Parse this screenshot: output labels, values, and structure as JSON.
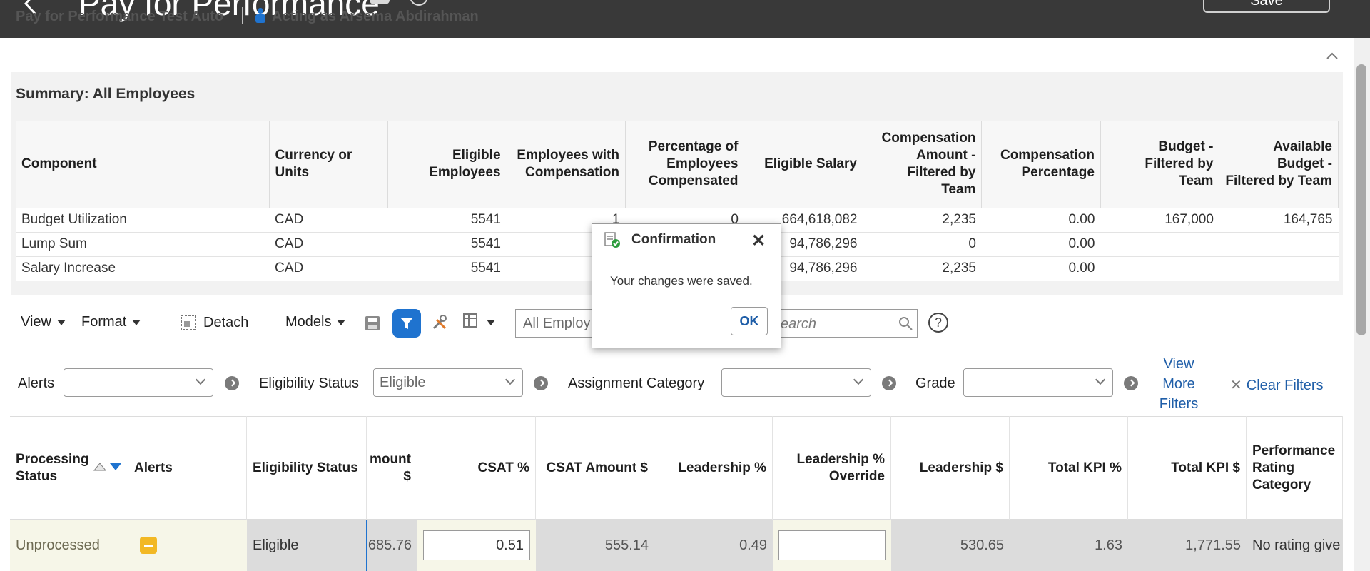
{
  "header": {
    "title": "Pay for Performance",
    "save_label": "Save"
  },
  "context": {
    "plan_name": "Pay for Performance Test Auto",
    "acting_as": "Acting as Arsema Abdirahman"
  },
  "summary": {
    "title": "Summary: All Employees",
    "columns": [
      "Component",
      "Currency or Units",
      "Eligible Employees",
      "Employees with Compensation",
      "Percentage of Employees Compensated",
      "Eligible Salary",
      "Compensation Amount - Filtered by Team",
      "Compensation Percentage",
      "Budget - Filtered by Team",
      "Available Budget - Filtered by Team"
    ],
    "rows": [
      {
        "component": "Budget Utilization",
        "currency": "CAD",
        "eligible": "5541",
        "with_comp": "1",
        "pct_comp": "0",
        "salary": "664,618,082",
        "comp_amount": "2,235",
        "comp_pct": "0.00",
        "budget": "167,000",
        "available": "164,765"
      },
      {
        "component": "Lump Sum",
        "currency": "CAD",
        "eligible": "5541",
        "with_comp": "",
        "pct_comp": "",
        "salary": "94,786,296",
        "comp_amount": "0",
        "comp_pct": "0.00",
        "budget": "",
        "available": ""
      },
      {
        "component": "Salary Increase",
        "currency": "CAD",
        "eligible": "5541",
        "with_comp": "",
        "pct_comp": "",
        "salary": "94,786,296",
        "comp_amount": "2,235",
        "comp_pct": "0.00",
        "budget": "",
        "available": ""
      }
    ]
  },
  "toolbar": {
    "view": "View",
    "format": "Format",
    "detach": "Detach",
    "models": "Models",
    "search_scope": "All Employ",
    "search_placeholder": "earch"
  },
  "filters": {
    "alerts_label": "Alerts",
    "alerts_value": "",
    "eligibility_label": "Eligibility Status",
    "eligibility_value": "Eligible",
    "assignment_label": "Assignment Category",
    "assignment_value": "",
    "grade_label": "Grade",
    "grade_value": "",
    "view_more": "View More Filters",
    "clear": "Clear Filters"
  },
  "grid": {
    "columns": [
      "Processing Status",
      "Alerts",
      "Eligibility Status",
      "mount $",
      "CSAT %",
      "CSAT Amount $",
      "Leadership %",
      "Leadership % Override",
      "Leadership $",
      "Total KPI %",
      "Total KPI $",
      "Performance Rating Category"
    ],
    "row": {
      "processing_status": "Unprocessed",
      "eligibility": "Eligible",
      "amount": "685.76",
      "csat_pct": "0.51",
      "csat_amount": "555.14",
      "leadership_pct": "0.49",
      "leadership_override": "",
      "leadership_amt": "530.65",
      "total_kpi_pct": "1.63",
      "total_kpi_amt": "1,771.55",
      "rating": "No rating give"
    }
  },
  "dialog": {
    "title": "Confirmation",
    "message": "Your changes were saved.",
    "ok": "OK"
  },
  "colors": {
    "header_bg": "#393939",
    "link": "#1f5ea8",
    "accent_blue": "#1f73cf",
    "alert_yellow": "#f2b824"
  }
}
